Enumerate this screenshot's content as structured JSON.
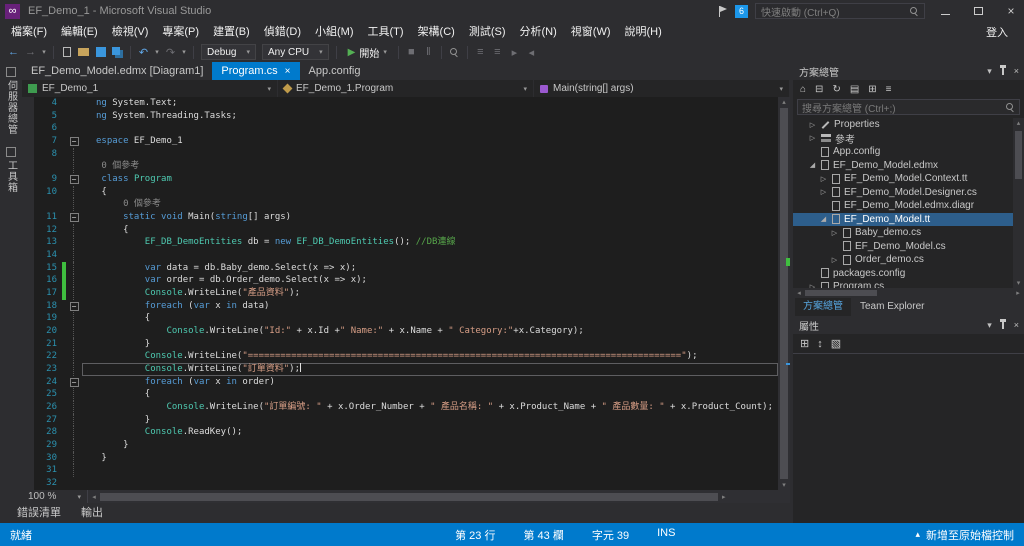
{
  "window": {
    "title": "EF_Demo_1 - Microsoft Visual Studio",
    "quick_launch_placeholder": "快速啟動 (Ctrl+Q)",
    "notification_count": "6"
  },
  "icons": {
    "infinity": "∞",
    "chevron_down": "▾",
    "close": "×",
    "play": "▶",
    "back": "←",
    "forward": "→",
    "undo": "↶",
    "redo": "↷",
    "stop": "■",
    "pause": "‖",
    "triangle_right": "▷",
    "tree_expanded": "◢",
    "minus": "−",
    "up": "▴",
    "down": "▾",
    "left": "◂",
    "right": "▸",
    "home": "⌂",
    "refresh": "↻",
    "collapse_all": "⊟",
    "grid": "⊞",
    "list": "≡",
    "files": "▤",
    "updown": "↕",
    "shade": "▧"
  },
  "menubar": {
    "items": [
      "檔案(F)",
      "編輯(E)",
      "檢視(V)",
      "專案(P)",
      "建置(B)",
      "偵錯(D)",
      "小組(M)",
      "工具(T)",
      "架構(C)",
      "測試(S)",
      "分析(N)",
      "視窗(W)",
      "說明(H)"
    ],
    "sign_in": "登入"
  },
  "toolbar": {
    "debug_target": "Debug",
    "platform": "Any CPU",
    "start_label": "開始"
  },
  "left_strip": {
    "tabs": [
      "伺服器總管",
      "工具箱"
    ]
  },
  "editor_tabs": [
    {
      "label": "EF_Demo_Model.edmx [Diagram1]",
      "active": false
    },
    {
      "label": "Program.cs",
      "active": true
    },
    {
      "label": "App.config",
      "active": false
    }
  ],
  "navbar": {
    "project": "EF_Demo_1",
    "class_name": "EF_Demo_1.Program",
    "member": "Main(string[] args)"
  },
  "editor": {
    "zoom": "100 %",
    "lines": [
      {
        "n": "4",
        "tokens": [
          [
            "ng",
            "k"
          ],
          [
            " System.Text;",
            "p"
          ]
        ]
      },
      {
        "n": "5",
        "tokens": [
          [
            "ng",
            "k"
          ],
          [
            " System.Threading.Tasks;",
            "p"
          ]
        ]
      },
      {
        "n": "6",
        "tokens": []
      },
      {
        "n": "7",
        "fold": true,
        "tokens": [
          [
            "espace",
            "k"
          ],
          [
            " EF_Demo_1",
            "p"
          ]
        ]
      },
      {
        "n": "8",
        "guide": true,
        "tokens": []
      },
      {
        "lens": true,
        "guide": true,
        "li": 1,
        "text": "0 個參考"
      },
      {
        "n": "9",
        "fold": true,
        "tokens": [
          [
            " ",
            "p"
          ],
          [
            "class",
            "k"
          ],
          [
            " ",
            "p"
          ],
          [
            "Program",
            "t"
          ]
        ]
      },
      {
        "n": "10",
        "guide": true,
        "tokens": [
          [
            " {",
            "p"
          ]
        ]
      },
      {
        "lens": true,
        "guide": true,
        "li": 5,
        "text": "0 個參考"
      },
      {
        "n": "11",
        "fold": true,
        "tokens": [
          [
            "     ",
            "p"
          ],
          [
            "static",
            "k"
          ],
          [
            " ",
            "p"
          ],
          [
            "void",
            "k"
          ],
          [
            " Main(",
            "p"
          ],
          [
            "string",
            "k"
          ],
          [
            "[] args)",
            "p"
          ]
        ]
      },
      {
        "n": "12",
        "guide": true,
        "tokens": [
          [
            "     {",
            "p"
          ]
        ]
      },
      {
        "n": "13",
        "guide": true,
        "tokens": [
          [
            "         ",
            "p"
          ],
          [
            "EF_DB_DemoEntities",
            "t"
          ],
          [
            " db = ",
            "p"
          ],
          [
            "new",
            "k"
          ],
          [
            " ",
            "p"
          ],
          [
            "EF_DB_DemoEntities",
            "t"
          ],
          [
            "(); ",
            "p"
          ],
          [
            "//DB連線",
            "c"
          ]
        ]
      },
      {
        "n": "14",
        "guide": true,
        "tokens": []
      },
      {
        "n": "15",
        "guide": true,
        "change": true,
        "tokens": [
          [
            "         ",
            "p"
          ],
          [
            "var",
            "k"
          ],
          [
            " data = db.Baby_demo.Select(x => x);",
            "p"
          ]
        ]
      },
      {
        "n": "16",
        "guide": true,
        "change": true,
        "tokens": [
          [
            "         ",
            "p"
          ],
          [
            "var",
            "k"
          ],
          [
            " order = db.Order_demo.Select(x => x);",
            "p"
          ]
        ]
      },
      {
        "n": "17",
        "guide": true,
        "change": true,
        "tokens": [
          [
            "         ",
            "p"
          ],
          [
            "Console",
            "t"
          ],
          [
            ".WriteLine(",
            "p"
          ],
          [
            "\"產品資料\"",
            "s"
          ],
          [
            ");",
            "p"
          ]
        ]
      },
      {
        "n": "18",
        "fold": true,
        "tokens": [
          [
            "         ",
            "p"
          ],
          [
            "foreach",
            "k"
          ],
          [
            " (",
            "p"
          ],
          [
            "var",
            "k"
          ],
          [
            " x ",
            "p"
          ],
          [
            "in",
            "k"
          ],
          [
            " data)",
            "p"
          ]
        ]
      },
      {
        "n": "19",
        "guide": true,
        "tokens": [
          [
            "         {",
            "p"
          ]
        ]
      },
      {
        "n": "20",
        "guide": true,
        "tokens": [
          [
            "             ",
            "p"
          ],
          [
            "Console",
            "t"
          ],
          [
            ".WriteLine(",
            "p"
          ],
          [
            "\"Id:\"",
            "s"
          ],
          [
            " + x.Id +",
            "p"
          ],
          [
            "\" Name:\"",
            "s"
          ],
          [
            " + x.Name + ",
            "p"
          ],
          [
            "\" Category:\"",
            "s"
          ],
          [
            "+x.Category);",
            "p"
          ]
        ]
      },
      {
        "n": "21",
        "guide": true,
        "tokens": [
          [
            "         }",
            "p"
          ]
        ]
      },
      {
        "n": "22",
        "guide": true,
        "tokens": [
          [
            "         ",
            "p"
          ],
          [
            "Console",
            "t"
          ],
          [
            ".WriteLine(",
            "p"
          ],
          [
            "\"================================================================================\"",
            "s"
          ],
          [
            ");",
            "p"
          ]
        ]
      },
      {
        "n": "23",
        "guide": true,
        "current": true,
        "caret": true,
        "tokens": [
          [
            "         ",
            "p"
          ],
          [
            "Console",
            "t"
          ],
          [
            ".WriteLine(",
            "p"
          ],
          [
            "\"訂單資料\"",
            "s"
          ],
          [
            ");",
            "p"
          ]
        ]
      },
      {
        "n": "24",
        "fold": true,
        "tokens": [
          [
            "         ",
            "p"
          ],
          [
            "foreach",
            "k"
          ],
          [
            " (",
            "p"
          ],
          [
            "var",
            "k"
          ],
          [
            " x ",
            "p"
          ],
          [
            "in",
            "k"
          ],
          [
            " order)",
            "p"
          ]
        ]
      },
      {
        "n": "25",
        "guide": true,
        "tokens": [
          [
            "         {",
            "p"
          ]
        ]
      },
      {
        "n": "26",
        "guide": true,
        "tokens": [
          [
            "             ",
            "p"
          ],
          [
            "Console",
            "t"
          ],
          [
            ".WriteLine(",
            "p"
          ],
          [
            "\"訂單編號: \"",
            "s"
          ],
          [
            " + x.Order_Number + ",
            "p"
          ],
          [
            "\" 產品名稱: \"",
            "s"
          ],
          [
            " + x.Product_Name + ",
            "p"
          ],
          [
            "\" 產品數量: \"",
            "s"
          ],
          [
            " + x.Product_Count);",
            "p"
          ]
        ]
      },
      {
        "n": "27",
        "guide": true,
        "tokens": [
          [
            "         }",
            "p"
          ]
        ]
      },
      {
        "n": "28",
        "guide": true,
        "tokens": [
          [
            "         ",
            "p"
          ],
          [
            "Console",
            "t"
          ],
          [
            ".ReadKey();",
            "p"
          ]
        ]
      },
      {
        "n": "29",
        "guide": true,
        "tokens": [
          [
            "     }",
            "p"
          ]
        ]
      },
      {
        "n": "30",
        "guide": true,
        "tokens": [
          [
            " }",
            "p"
          ]
        ]
      },
      {
        "n": "31",
        "guide": true,
        "tokens": []
      },
      {
        "n": "32",
        "tokens": []
      }
    ]
  },
  "solution_explorer": {
    "title": "方案總管",
    "search_placeholder": "搜尋方案總管 (Ctrl+;)",
    "items": [
      {
        "label": "Properties",
        "indent": 1,
        "arrow": "collapsed",
        "icon": "wrench"
      },
      {
        "label": "參考",
        "indent": 1,
        "arrow": "collapsed",
        "icon": "ref"
      },
      {
        "label": "App.config",
        "indent": 1,
        "arrow": "none",
        "icon": "page"
      },
      {
        "label": "EF_Demo_Model.edmx",
        "indent": 1,
        "arrow": "expanded",
        "icon": "page"
      },
      {
        "label": "EF_Demo_Model.Context.tt",
        "indent": 2,
        "arrow": "collapsed",
        "icon": "page"
      },
      {
        "label": "EF_Demo_Model.Designer.cs",
        "indent": 2,
        "arrow": "collapsed",
        "icon": "page"
      },
      {
        "label": "EF_Demo_Model.edmx.diagr",
        "indent": 2,
        "arrow": "none",
        "icon": "page"
      },
      {
        "label": "EF_Demo_Model.tt",
        "indent": 2,
        "arrow": "expanded",
        "icon": "page",
        "selected": true
      },
      {
        "label": "Baby_demo.cs",
        "indent": 3,
        "arrow": "collapsed",
        "icon": "page"
      },
      {
        "label": "EF_Demo_Model.cs",
        "indent": 3,
        "arrow": "none",
        "icon": "page"
      },
      {
        "label": "Order_demo.cs",
        "indent": 3,
        "arrow": "collapsed",
        "icon": "page"
      },
      {
        "label": "packages.config",
        "indent": 1,
        "arrow": "none",
        "icon": "page"
      },
      {
        "label": "Program.cs",
        "indent": 1,
        "arrow": "collapsed",
        "icon": "page"
      }
    ],
    "bottom_tabs": [
      "方案總管",
      "Team Explorer"
    ]
  },
  "properties_panel": {
    "title": "屬性"
  },
  "bottom_panel": {
    "tabs": [
      "錯誤清單",
      "輸出"
    ]
  },
  "status_bar": {
    "ready": "就緒",
    "line": "第 23 行",
    "column": "第 43 欄",
    "character": "字元 39",
    "mode": "INS",
    "source_control": "新增至原始檔控制"
  }
}
